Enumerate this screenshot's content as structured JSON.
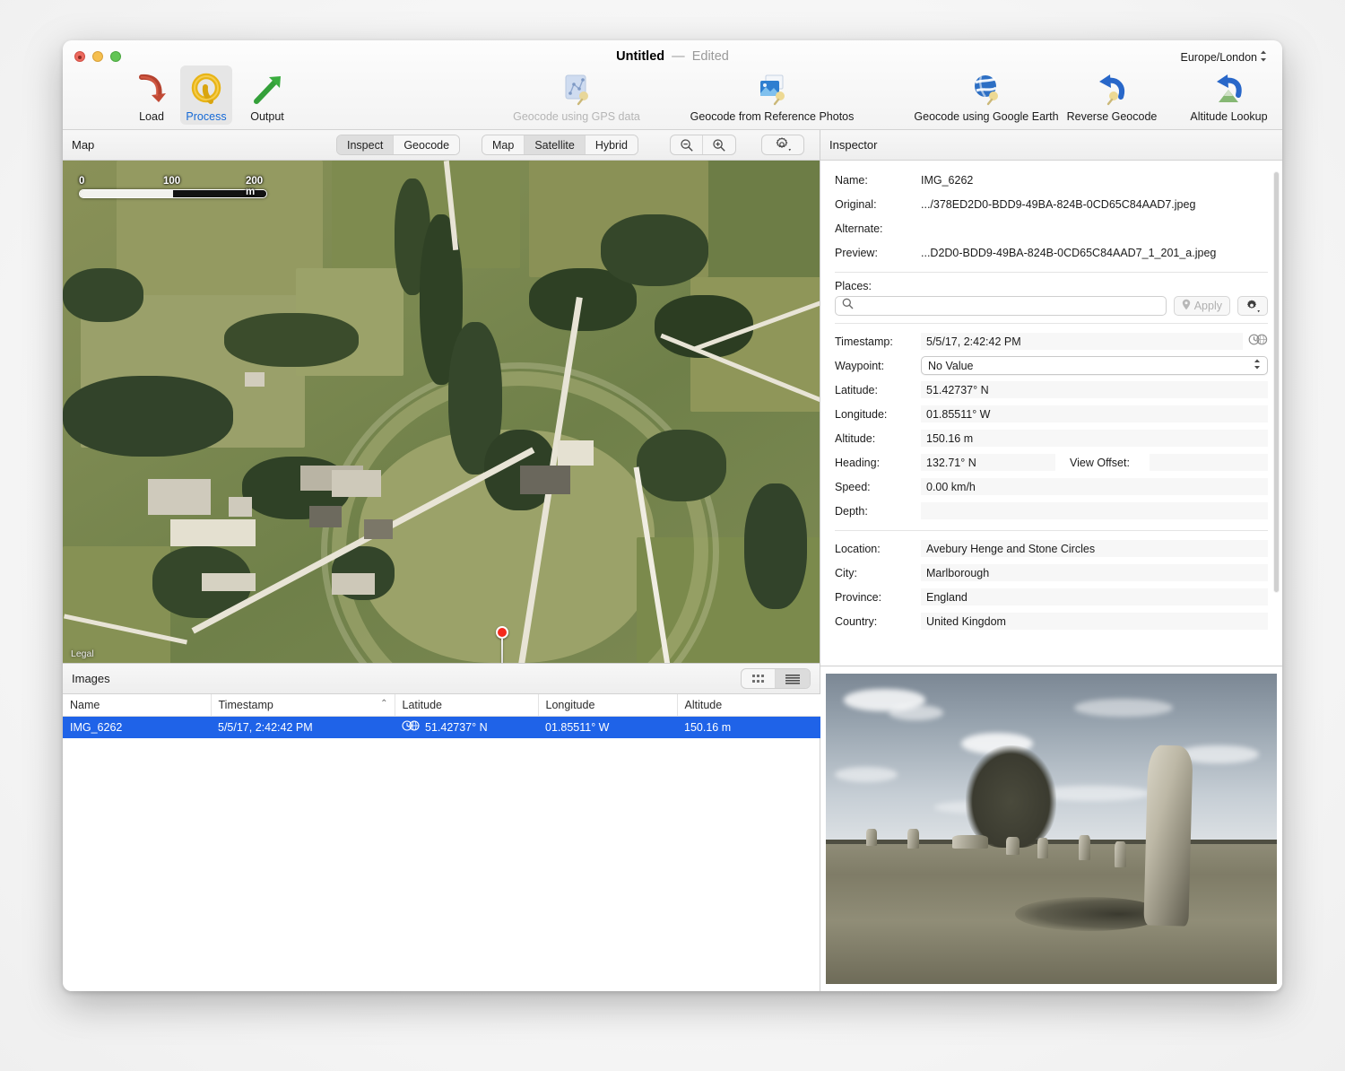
{
  "window": {
    "title": "Untitled",
    "title_separator": "—",
    "edited_badge": "Edited",
    "timezone_popup": "Europe/London",
    "timezone_chevron": "⌃⌄"
  },
  "toolbar": {
    "items": [
      {
        "label": "Load",
        "icon": "load-arrow-icon",
        "state": "normal"
      },
      {
        "label": "Process",
        "icon": "process-q-icon",
        "state": "selected"
      },
      {
        "label": "Output",
        "icon": "output-arrow-icon",
        "state": "normal"
      },
      {
        "label": "Geocode using GPS data",
        "icon": "gps-track-pin-icon",
        "state": "disabled"
      },
      {
        "label": "Geocode from Reference Photos",
        "icon": "photos-pin-icon",
        "state": "normal"
      },
      {
        "label": "Geocode using Google Earth",
        "icon": "google-earth-pin-icon",
        "state": "normal"
      },
      {
        "label": "Reverse Geocode",
        "icon": "reverse-arrow-pin-icon",
        "state": "normal"
      },
      {
        "label": "Altitude Lookup",
        "icon": "altitude-arrow-icon",
        "state": "normal"
      }
    ]
  },
  "map_panel": {
    "title": "Map",
    "mode_segment": {
      "options": [
        "Inspect",
        "Geocode"
      ],
      "selected": "Inspect"
    },
    "type_segment": {
      "options": [
        "Map",
        "Satellite",
        "Hybrid"
      ],
      "selected": "Satellite"
    },
    "zoom_out_icon": "magnifier-minus-icon",
    "zoom_in_icon": "magnifier-plus-icon",
    "settings_icon": "gear-dropdown-icon",
    "scalebar": {
      "ticks": [
        "0",
        "100",
        "200 m"
      ]
    },
    "legal_link": "Legal",
    "pin": {
      "latitude": "51.42737° N",
      "longitude": "01.85511° W"
    }
  },
  "images_panel": {
    "title": "Images",
    "view_toggle": {
      "options": [
        "grid-view-icon",
        "list-view-icon"
      ],
      "selected": "list-view-icon"
    },
    "columns": [
      "Name",
      "Timestamp",
      "Latitude",
      "Longitude",
      "Altitude"
    ],
    "sorted_column": "Timestamp",
    "sort_direction": "ascending",
    "sort_indicator": "⌃",
    "rows": [
      {
        "name": "IMG_6262",
        "timestamp": "5/5/17, 2:42:42 PM",
        "latitude": "51.42737° N",
        "longitude": "01.85511° W",
        "altitude": "150.16 m",
        "time_icon": "clock-globe-icon",
        "selected": true
      }
    ]
  },
  "inspector": {
    "title": "Inspector",
    "file": {
      "name_label": "Name:",
      "name_value": "IMG_6262",
      "original_label": "Original:",
      "original_value": ".../378ED2D0-BDD9-49BA-824B-0CD65C84AAD7.jpeg",
      "alternate_label": "Alternate:",
      "alternate_value": "",
      "preview_label": "Preview:",
      "preview_value": "...D2D0-BDD9-49BA-824B-0CD65C84AAD7_1_201_a.jpeg"
    },
    "places": {
      "label": "Places:",
      "search_value": "",
      "search_placeholder": "",
      "search_icon": "search-icon",
      "apply_label": "Apply",
      "apply_icon": "map-pin-icon",
      "apply_enabled": false,
      "gear_icon": "gear-dropdown-icon"
    },
    "metadata": [
      {
        "label": "Timestamp:",
        "value": "5/5/17, 2:42:42 PM",
        "kind": "text",
        "accessory": "clock-globe-icon"
      },
      {
        "label": "Waypoint:",
        "value": "No Value",
        "kind": "popup"
      },
      {
        "label": "Latitude:",
        "value": "51.42737° N",
        "kind": "text"
      },
      {
        "label": "Longitude:",
        "value": "01.85511° W",
        "kind": "text"
      },
      {
        "label": "Altitude:",
        "value": "150.16 m",
        "kind": "text"
      },
      {
        "label": "Heading:",
        "value": "132.71° N",
        "kind": "text",
        "extra_label": "View Offset:",
        "extra_value": ""
      },
      {
        "label": "Speed:",
        "value": "0.00 km/h",
        "kind": "text"
      },
      {
        "label": "Depth:",
        "value": "",
        "kind": "text"
      }
    ],
    "location": [
      {
        "label": "Location:",
        "value": "Avebury Henge and Stone Circles"
      },
      {
        "label": "City:",
        "value": "Marlborough"
      },
      {
        "label": "Province:",
        "value": "England"
      },
      {
        "label": "Country:",
        "value": "United Kingdom"
      }
    ]
  },
  "photo_preview": {
    "alt_description": "Black and white photograph of standing stones at Avebury with a large tree and open field"
  },
  "colors": {
    "accent_selection": "#1f63e8",
    "accent_label": "#1569d6",
    "pin_red": "#f4291d",
    "toolbar_bg": "#f3f3f3",
    "panel_bg": "#ffffff"
  }
}
